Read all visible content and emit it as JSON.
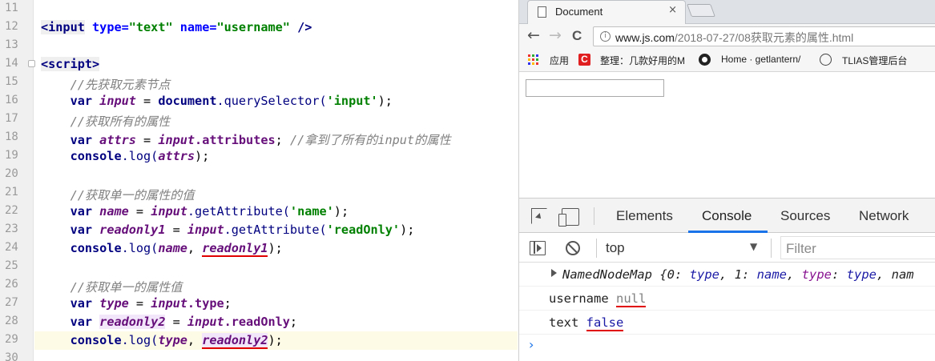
{
  "editor": {
    "lines": [
      {
        "n": "11"
      },
      {
        "n": "12"
      },
      {
        "n": "13"
      },
      {
        "n": "14"
      },
      {
        "n": "15"
      },
      {
        "n": "16"
      },
      {
        "n": "17"
      },
      {
        "n": "18"
      },
      {
        "n": "19"
      },
      {
        "n": "20"
      },
      {
        "n": "21"
      },
      {
        "n": "22"
      },
      {
        "n": "23"
      },
      {
        "n": "24"
      },
      {
        "n": "25"
      },
      {
        "n": "26"
      },
      {
        "n": "27"
      },
      {
        "n": "28"
      },
      {
        "n": "29"
      },
      {
        "n": "30"
      }
    ],
    "code": {
      "l12_tag": "<input",
      "l12_a1": "type=",
      "l12_s1": "\"text\"",
      "l12_a2": "name=",
      "l12_s2": "\"username\"",
      "l12_end": " />",
      "l14": "<script>",
      "l15": "//先获取元素节点",
      "l16_var": "var",
      "l16_name": "input",
      "l16_eq": " = ",
      "l16_doc": "document",
      "l16_fn": ".querySelector(",
      "l16_str": "'input'",
      "l16_end": ");",
      "l17": "//获取所有的属性",
      "l18_var": "var",
      "l18_name": "attrs",
      "l18_eq": " = ",
      "l18_obj": "input",
      "l18_prop": ".attributes",
      "l18_semi": "; ",
      "l18_cmt": "//拿到了所有的input的属性",
      "l19_con": "console",
      "l19_fn": ".log(",
      "l19_arg": "attrs",
      "l19_end": ");",
      "l21": "//获取单一的属性的值",
      "l22_var": "var",
      "l22_name": "name",
      "l22_eq": " = ",
      "l22_obj": "input",
      "l22_fn": ".getAttribute(",
      "l22_str": "'name'",
      "l22_end": ");",
      "l23_var": "var",
      "l23_name": "readonly1",
      "l23_eq": " = ",
      "l23_obj": "input",
      "l23_fn": ".getAttribute(",
      "l23_str": "'readOnly'",
      "l23_end": ");",
      "l24_con": "console",
      "l24_fn": ".log(",
      "l24_a1": "name",
      "l24_comma": ", ",
      "l24_a2": "readonly1",
      "l24_end": ");",
      "l26": "//获取单一的属性值",
      "l27_var": "var",
      "l27_name": "type",
      "l27_eq": " = ",
      "l27_obj": "input",
      "l27_prop": ".type",
      "l27_end": ";",
      "l28_var": "var",
      "l28_name": "readonly2",
      "l28_eq": " = ",
      "l28_obj": "input",
      "l28_prop": ".readOnly",
      "l28_end": ";",
      "l29_con": "console",
      "l29_fn": ".log(",
      "l29_a1": "type",
      "l29_comma": ", ",
      "l29_a2": "readonly2",
      "l29_end": ");"
    }
  },
  "browser": {
    "tab_title": "Document",
    "tab_close": "×",
    "nav": {
      "back": "←",
      "forward": "→",
      "reload": "C"
    },
    "url_host": "www.js.com",
    "url_path": "/2018-07-27/08获取元素的属性.html",
    "bookmarks": {
      "apps": "应用",
      "b1": "整理：几款好用的M",
      "b2": "Home · getlantern/",
      "b3": "TLIAS管理后台"
    }
  },
  "devtools": {
    "tabs": [
      "Elements",
      "Console",
      "Sources",
      "Network"
    ],
    "active_tab": "Console",
    "context": "top",
    "context_arrow": "▼",
    "filter_placeholder": "Filter",
    "console": {
      "line1_label": "NamedNodeMap",
      "line1_preview": " {0: ",
      "line1_v0": "type",
      "line1_c1": ", 1: ",
      "line1_v1": "name",
      "line1_c2": ", ",
      "line1_k": "type",
      "line1_c3": ": ",
      "line1_v2": "type",
      "line1_c4": ", nam",
      "line2_text": "username ",
      "line2_val": "null",
      "line3_text": "text ",
      "line3_val": "false",
      "prompt": "›"
    }
  },
  "colors": {
    "tab_active_underline": "#1a73e8",
    "error_underline": "#e00000",
    "current_line": "#fdfbe6"
  }
}
